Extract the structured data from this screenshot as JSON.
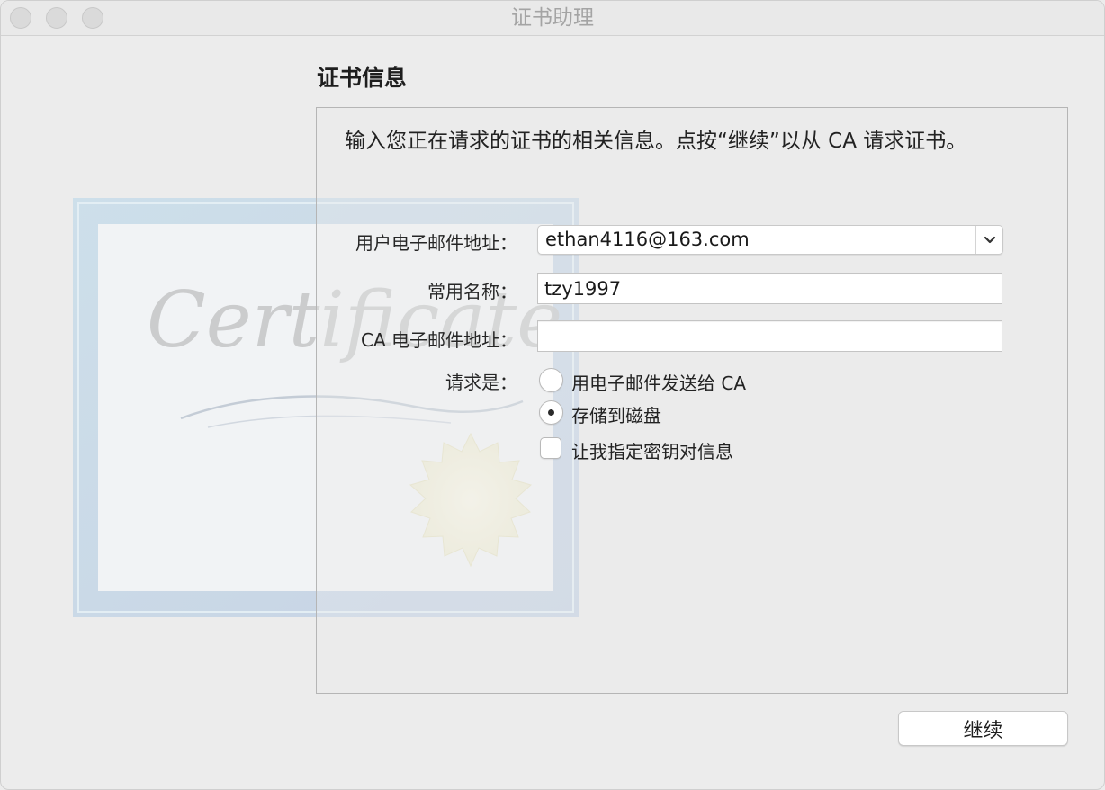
{
  "window": {
    "title": "证书助理"
  },
  "section": {
    "title": "证书信息",
    "intro": "输入您正在请求的证书的相关信息。点按“继续”以从 CA 请求证书。"
  },
  "artwork": {
    "script_text": "Certificate"
  },
  "fields": {
    "email_label": "用户电子邮件地址：",
    "email_value": "ethan4116@163.com",
    "name_label": "常用名称：",
    "name_value": "tzy1997",
    "ca_email_label": "CA 电子邮件地址：",
    "ca_email_value": ""
  },
  "request": {
    "label": "请求是：",
    "option_email": "用电子邮件发送给 CA",
    "option_disk": "存储到磁盘",
    "selected": "存储到磁盘",
    "keypair_label": "让我指定密钥对信息",
    "keypair_checked": false
  },
  "actions": {
    "continue_label": "继续"
  },
  "colors": {
    "window_bg": "#ececec",
    "panel_border": "#b5b5b5",
    "title_text": "#a4a4a4"
  },
  "icons": {
    "dropdown": "chevron-down-icon",
    "artwork": "certificate-icon"
  }
}
